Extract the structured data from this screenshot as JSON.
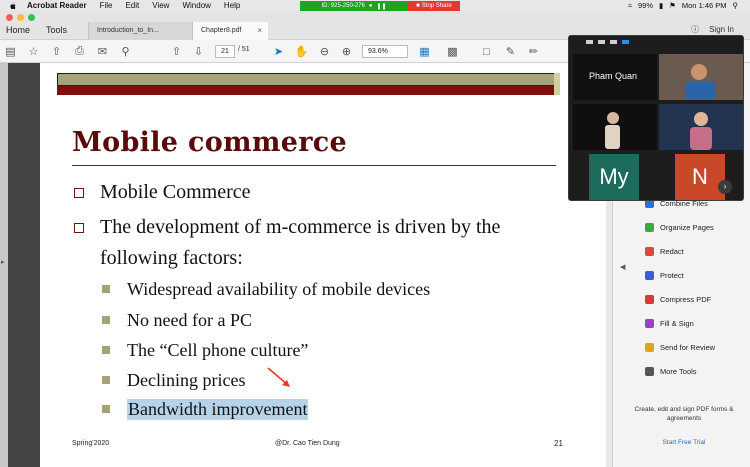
{
  "menubar": {
    "app": "Acrobat Reader",
    "items": [
      "File",
      "Edit",
      "View",
      "Window",
      "Help"
    ],
    "battery": "99%",
    "clock": "Mon 1:46 PM"
  },
  "zoom_share": {
    "meeting_id": "ID: 925-250-276",
    "stop_label": "Stop Share"
  },
  "tabs": {
    "home": "Home",
    "tools": "Tools",
    "docs": [
      {
        "label": "Introduction_to_In..."
      },
      {
        "label": "Chapter8.pdf"
      }
    ],
    "sign_in": "Sign In"
  },
  "toolbar": {
    "page_current": "21",
    "page_total": "/ 51",
    "zoom": "93.6%"
  },
  "slide": {
    "title": "Mobile commerce",
    "bullets": [
      "Mobile Commerce",
      "The development of m-commerce is driven by the",
      "following factors:"
    ],
    "sub_bullets": [
      "Widespread availability of mobile devices",
      "No need for a PC",
      "The “Cell phone culture”",
      "Declining prices",
      "Bandwidth improvement"
    ],
    "footer_left": "Spring'2020",
    "footer_mid": "@Dr. Cao Tien Dung",
    "footer_right": "21"
  },
  "tools_panel": {
    "items": [
      {
        "label": "Combine Files",
        "color": "#2d6fd6"
      },
      {
        "label": "Organize Pages",
        "color": "#39a845"
      },
      {
        "label": "Redact",
        "color": "#e04545"
      },
      {
        "label": "Protect",
        "color": "#3b5bdb"
      },
      {
        "label": "Compress PDF",
        "color": "#d6393b"
      },
      {
        "label": "Fill & Sign",
        "color": "#9b3fc4"
      },
      {
        "label": "Send for Review",
        "color": "#e3a21a"
      },
      {
        "label": "More Tools",
        "color": "#555555"
      }
    ],
    "note": "Create, edit and sign PDF forms & agreements",
    "trial": "Start Free Trial"
  },
  "gallery": {
    "participant_name": "Pham Quan",
    "avatar_my": "My",
    "avatar_n": "N",
    "my_color": "#1d6b5c",
    "n_color": "#c9482a"
  }
}
